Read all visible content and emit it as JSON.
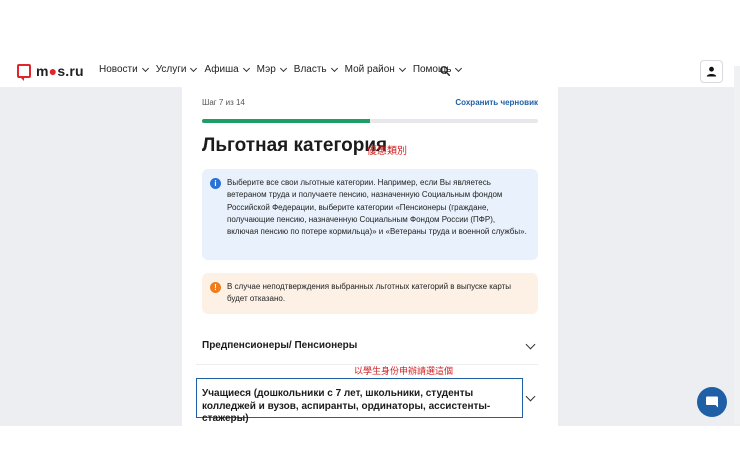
{
  "header": {
    "logo_prefix": "m",
    "logo_accent": "●",
    "logo_suffix": "s.ru",
    "nav": [
      {
        "label": "Новости"
      },
      {
        "label": "Услуги"
      },
      {
        "label": "Афиша"
      },
      {
        "label": "Мэр"
      },
      {
        "label": "Власть"
      },
      {
        "label": "Мой район"
      },
      {
        "label": "Помощь"
      }
    ],
    "search_icon": "search-icon",
    "profile_icon": "user-icon"
  },
  "form": {
    "step_text": "Шаг 7 из 14",
    "save_draft": "Сохранить черновик",
    "progress": 0.5,
    "title": "Льготная категория",
    "title_note": "優惠類別",
    "info_text": "Выберите все свои льготные категории. Например, если Вы являетесь ветераном труда и получаете пенсию, назначенную Социальным фондом Российской Федерации, выберите категории «Пенсионеры (граждане, получающие пенсию, назначенную Социальным Фондом России (ПФР), включая пенсию по потере кормильца)» и «Ветераны труда и военной службы».",
    "warning_text": "В случае неподтверждения выбранных льготных категорий в выпуске карты будет отказано.",
    "accordions": [
      {
        "label": "Предпенсионеры/ Пенсионеры"
      },
      {
        "label": "Учащиеся (дошкольники с 7 лет, школьники, студенты колледжей и вузов, аспиранты, ординаторы, ассистенты-стажеры)"
      }
    ],
    "hand_note": "以學生身份申辦請選這個"
  },
  "colors": {
    "accent_red": "#e0252b",
    "link_blue": "#1f5fa6",
    "progress_green": "#1f9d67",
    "info_bg": "#e9f2fc",
    "warn_bg": "#fdf1e6"
  },
  "chat_icon": "chat-bubble-icon"
}
